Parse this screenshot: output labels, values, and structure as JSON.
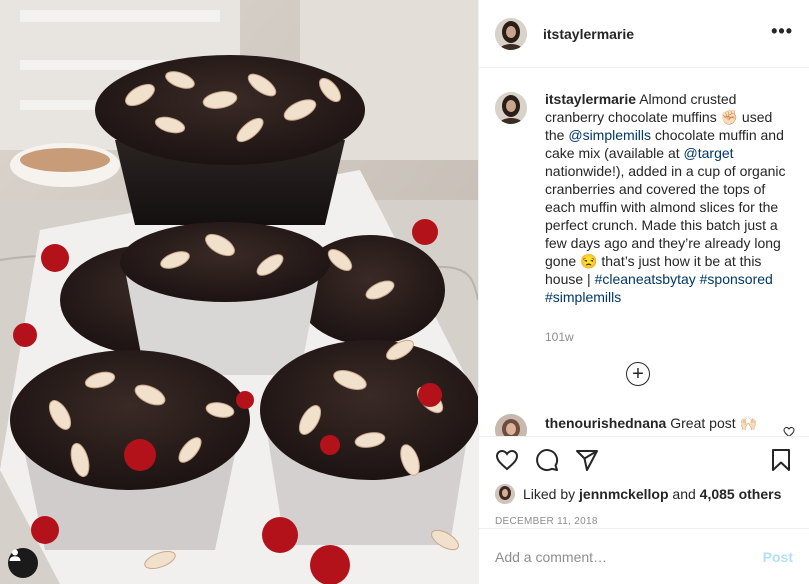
{
  "post": {
    "author": "itstaylermarie",
    "more_glyph": "•••",
    "caption": {
      "seg1": "Almond crusted cranberry chocolate muffins ",
      "emoji1": "✊🏻",
      "seg2": " used the ",
      "mention1": "@simplemills",
      "seg3": " chocolate muffin and cake mix (available at ",
      "mention2": "@target",
      "seg4": " nationwide!), added in a cup of organic cranberries and covered the tops of each muffin with almond slices for the perfect crunch. Made this batch just a few days ago and they’re already long gone ",
      "emoji2": "😒",
      "seg5": " that’s just how it be at this house | ",
      "tag1": "#cleaneatsbytay",
      "tag2": "#sponsored",
      "tag3": "#simplemills"
    },
    "caption_age": "101w",
    "load_more_glyph": "+",
    "comment": {
      "author": "thenourishednana",
      "text": "Great post ",
      "emoji": "🙌🏻"
    },
    "likes": {
      "prefix": "Liked by ",
      "user": "jennmckellop",
      "middle": " and ",
      "count": "4,085 others"
    },
    "date": "DECEMBER 11, 2018",
    "add_comment_placeholder": "Add a comment…",
    "post_label": "Post"
  },
  "icons": [
    "user-tag-icon",
    "heart-icon",
    "comment-icon",
    "share-icon",
    "bookmark-icon",
    "more-icon",
    "plus-circle-icon"
  ]
}
